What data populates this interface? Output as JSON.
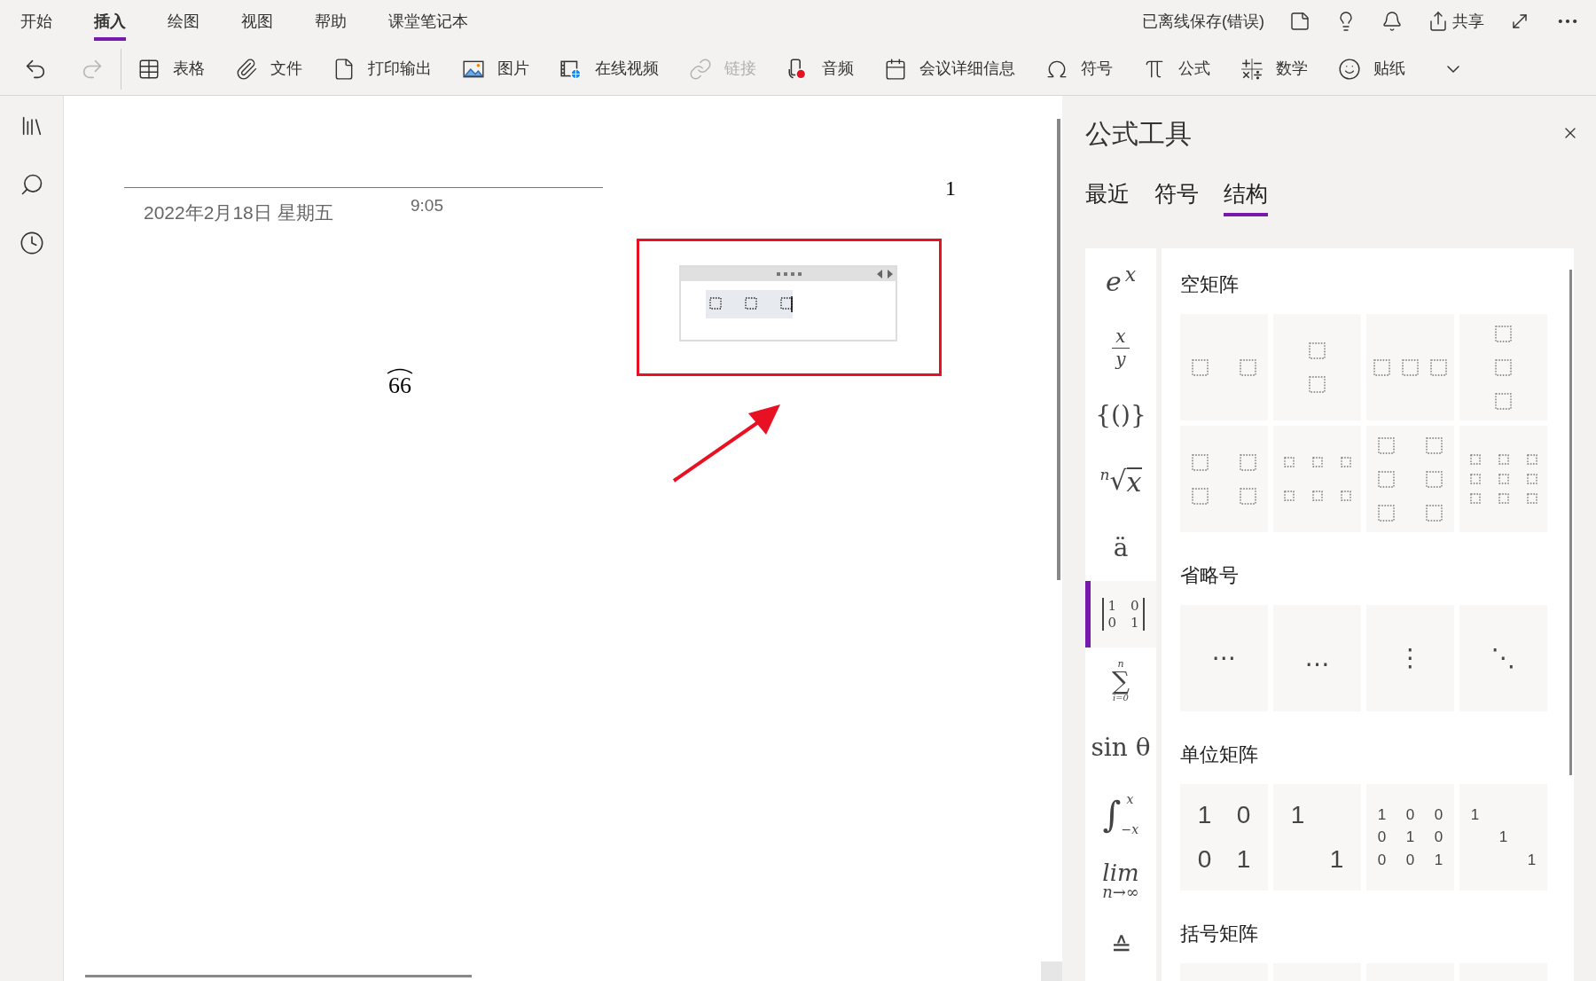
{
  "ribbon_tabs": [
    {
      "label": "开始",
      "selected": false
    },
    {
      "label": "插入",
      "selected": true
    },
    {
      "label": "绘图",
      "selected": false
    },
    {
      "label": "视图",
      "selected": false
    },
    {
      "label": "帮助",
      "selected": false
    },
    {
      "label": "课堂笔记本",
      "selected": false
    }
  ],
  "status": "已离线保存(错误)",
  "share_label": "共享",
  "toolbar": [
    {
      "label": "表格",
      "disabled": false
    },
    {
      "label": "文件",
      "disabled": false
    },
    {
      "label": "打印输出",
      "disabled": false
    },
    {
      "label": "图片",
      "disabled": false
    },
    {
      "label": "在线视频",
      "disabled": false
    },
    {
      "label": "链接",
      "disabled": true
    },
    {
      "label": "音频",
      "disabled": false
    },
    {
      "label": "会议详细信息",
      "disabled": false
    },
    {
      "label": "符号",
      "disabled": false
    },
    {
      "label": "公式",
      "disabled": false
    },
    {
      "label": "数学",
      "disabled": false
    },
    {
      "label": "贴纸",
      "disabled": false
    }
  ],
  "page": {
    "date": "2022年2月18日 星期五",
    "time": "9:05",
    "page_number": "1",
    "arc_text": "66"
  },
  "panel": {
    "title": "公式工具",
    "tabs": [
      {
        "label": "最近",
        "selected": false
      },
      {
        "label": "符号",
        "selected": false
      },
      {
        "label": "结构",
        "selected": true
      }
    ],
    "categories": [
      {
        "kind": "power",
        "a": "e",
        "b": "x",
        "selected": false
      },
      {
        "kind": "fraction",
        "a": "x",
        "b": "y",
        "selected": false
      },
      {
        "kind": "text",
        "a": "{()}",
        "selected": false
      },
      {
        "kind": "root",
        "a": "n",
        "b": "x",
        "sign": "√",
        "selected": false
      },
      {
        "kind": "text",
        "a": "ä",
        "selected": false
      },
      {
        "kind": "matrix",
        "cells": [
          "1",
          "0",
          "0",
          "1"
        ],
        "selected": true
      },
      {
        "kind": "sum",
        "a": "n",
        "b": "i=0",
        "sign": "∑",
        "selected": false
      },
      {
        "kind": "text",
        "a": "sin θ",
        "selected": false
      },
      {
        "kind": "integral",
        "a": "x",
        "b": "−x",
        "sign": "∫",
        "selected": false
      },
      {
        "kind": "limit",
        "a": "lim",
        "b": "n→∞",
        "selected": false
      },
      {
        "kind": "text",
        "a": "≙",
        "selected": false
      }
    ],
    "sections": [
      {
        "title": "空矩阵",
        "items": [
          {
            "kind": "pair"
          },
          {
            "kind": "stackpair"
          },
          {
            "kind": "triple"
          },
          {
            "kind": "stacktriple"
          },
          {
            "kind": "square"
          },
          {
            "kind": "wide"
          },
          {
            "kind": "tall"
          },
          {
            "kind": "grid"
          }
        ]
      },
      {
        "title": "省略号",
        "items": [
          {
            "kind": "text",
            "text": "⋯"
          },
          {
            "kind": "text",
            "text": "…"
          },
          {
            "kind": "text",
            "text": "⋮"
          },
          {
            "kind": "text",
            "text": "⋱"
          }
        ]
      },
      {
        "title": "单位矩阵",
        "items": [
          {
            "kind": "identity",
            "rows": [
              [
                "1",
                "0"
              ],
              [
                "0",
                "1"
              ]
            ]
          },
          {
            "kind": "identity",
            "rows": [
              [
                "1",
                null
              ],
              [
                null,
                "1"
              ]
            ]
          },
          {
            "kind": "identity",
            "rows": [
              [
                "1",
                "0",
                "0"
              ],
              [
                "0",
                "1",
                "0"
              ],
              [
                "0",
                "0",
                "1"
              ]
            ]
          },
          {
            "kind": "identity",
            "rows": [
              [
                "1",
                null,
                null
              ],
              [
                null,
                "1",
                null
              ],
              [
                null,
                null,
                "1"
              ]
            ]
          }
        ]
      },
      {
        "title": "括号矩阵",
        "items": [
          {
            "kind": "blank"
          },
          {
            "kind": "blank"
          },
          {
            "kind": "blank"
          },
          {
            "kind": "blank"
          }
        ]
      }
    ]
  }
}
